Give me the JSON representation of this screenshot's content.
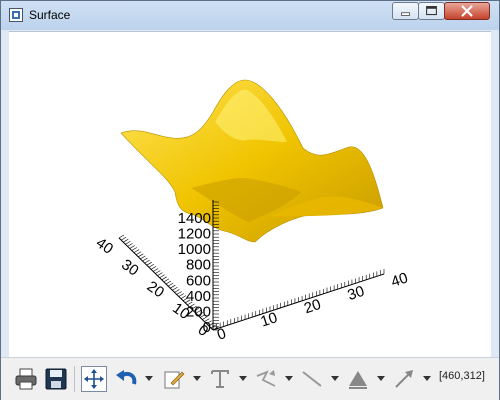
{
  "window": {
    "title": "Surface"
  },
  "plot": {
    "z_axis_ticks": [
      "1400",
      "1200",
      "1000",
      "800",
      "600",
      "400",
      "200",
      "0"
    ],
    "x_axis_ticks": [
      "0",
      "10",
      "20",
      "30",
      "40"
    ],
    "y_axis_ticks": [
      "0",
      "10",
      "20",
      "30",
      "40"
    ],
    "surface_color": "#f2c500"
  },
  "toolbar": {
    "icons": [
      "print-icon",
      "save-icon",
      "pan-icon",
      "undo-icon",
      "annotate-icon",
      "text-icon",
      "polyline-icon",
      "line-icon",
      "fill-icon",
      "arrow-icon"
    ],
    "coordinates": "[460,312]"
  }
}
